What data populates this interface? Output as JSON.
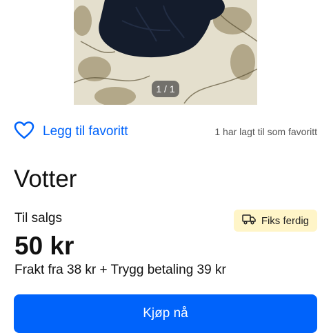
{
  "gallery": {
    "counter": "1 / 1"
  },
  "favorite": {
    "label": "Legg til favoritt",
    "count_text": "1 har lagt til som favoritt"
  },
  "listing": {
    "title": "Votter",
    "status": "Til salgs",
    "badge": {
      "label": "Fiks ferdig",
      "icon": "delivery-truck-icon"
    },
    "price": "50 kr",
    "shipping": "Frakt fra 38 kr + Trygg betaling 39 kr"
  },
  "buy_button": {
    "label": "Kjøp nå"
  },
  "colors": {
    "accent": "#0063fb",
    "badge_bg": "#fff5c8",
    "text": "#111111"
  }
}
